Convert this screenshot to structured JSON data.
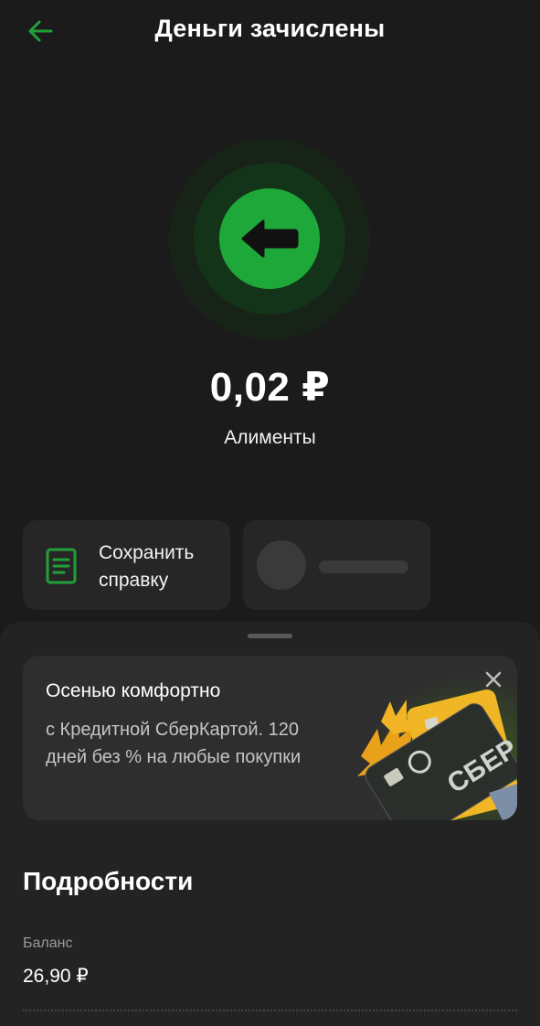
{
  "header": {
    "title": "Деньги зачислены",
    "back_icon": "arrow-left-icon",
    "accent_color": "#21a038"
  },
  "hero": {
    "icon": "arrow-left-icon",
    "amount": "0,02 ₽",
    "subtitle": "Алименты"
  },
  "actions": {
    "save_label": "Сохранить справку",
    "save_icon": "document-icon"
  },
  "promo": {
    "title": "Осенью комфортно",
    "text": "с Кредитной СберКартой. 120 дней без % на любые покупки",
    "close_icon": "close-icon",
    "card_brand": "СБЕР"
  },
  "details": {
    "title": "Подробности",
    "balance_label": "Баланс",
    "balance_value": "26,90 ₽"
  }
}
